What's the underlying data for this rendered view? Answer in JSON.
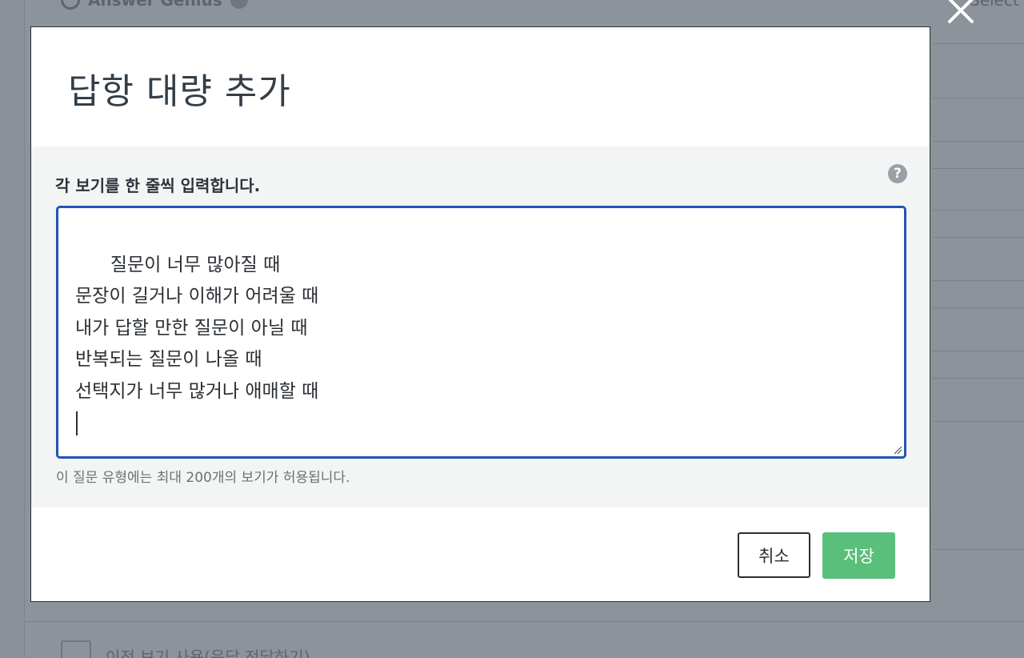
{
  "background": {
    "top_label": "Answer Genius",
    "right_label": "Select",
    "bottom_label": "이전 보기 사용(응답 전달하기)"
  },
  "modal": {
    "title": "답항 대량 추가",
    "instruction": "각 보기를 한 줄씩 입력합니다.",
    "help_symbol": "?",
    "answers_text": "질문이 너무 많아질 때\n문장이 길거나 이해가 어려울 때\n내가 답할 만한 질문이 아닐 때\n반복되는 질문이 나올 때\n선택지가 너무 많거나 애매할 때\n",
    "limit_note": "이 질문 유형에는 최대 200개의 보기가 허용됩니다.",
    "cancel_label": "취소",
    "save_label": "저장"
  },
  "colors": {
    "save_button": "#59bf7a",
    "textarea_focus_border": "#1f56b3",
    "overlay": "#8b9198"
  }
}
